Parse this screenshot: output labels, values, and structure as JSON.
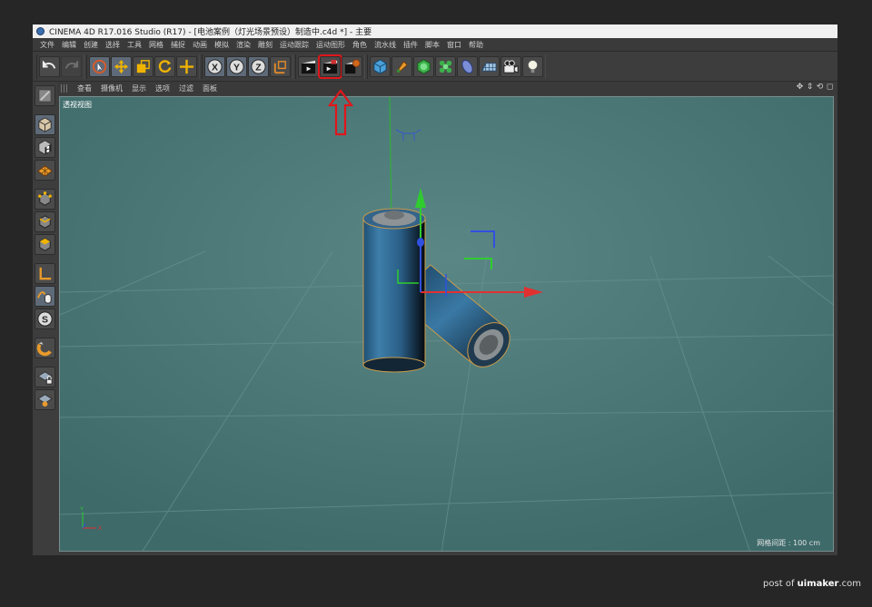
{
  "titlebar": {
    "title": "CINEMA 4D R17.016 Studio (R17) - [电池案例（灯光场景预设）制造中.c4d *] - 主要"
  },
  "menubar": {
    "items": [
      "文件",
      "编辑",
      "创建",
      "选择",
      "工具",
      "网格",
      "捕捉",
      "动画",
      "模拟",
      "渲染",
      "雕刻",
      "运动跟踪",
      "运动图形",
      "角色",
      "流水线",
      "插件",
      "脚本",
      "窗口",
      "帮助"
    ]
  },
  "toolbar": {
    "undo": "undo-icon",
    "redo": "redo-icon",
    "tools": [
      "live-select-icon",
      "move-icon",
      "scale-icon",
      "rotate-icon",
      "recent-tool-icon"
    ],
    "axes": [
      "X",
      "Y",
      "Z"
    ],
    "coord": "coordinate-system-icon",
    "render": [
      "render-view-icon",
      "render-to-picture-viewer-icon",
      "render-settings-icon"
    ],
    "objects": [
      "cube-icon",
      "pen-icon",
      "subdivision-icon",
      "cloner-icon",
      "deformer-icon",
      "floor-icon",
      "camera-icon",
      "light-icon"
    ]
  },
  "viewport_menu": {
    "items": [
      "查看",
      "摄像机",
      "显示",
      "选项",
      "过滤",
      "面板"
    ]
  },
  "viewport": {
    "label": "透视视图",
    "grid_distance": "网格间距 : 100 cm"
  },
  "axis_gizmo": {
    "y": "Y",
    "x": "X"
  },
  "watermark": {
    "prefix": "post of ",
    "site": "uimaker",
    "suffix": ".com"
  },
  "colors": {
    "viewport_bg": "#4f7b7a",
    "highlight": "#e0161b",
    "battery": "#2c5f86"
  }
}
